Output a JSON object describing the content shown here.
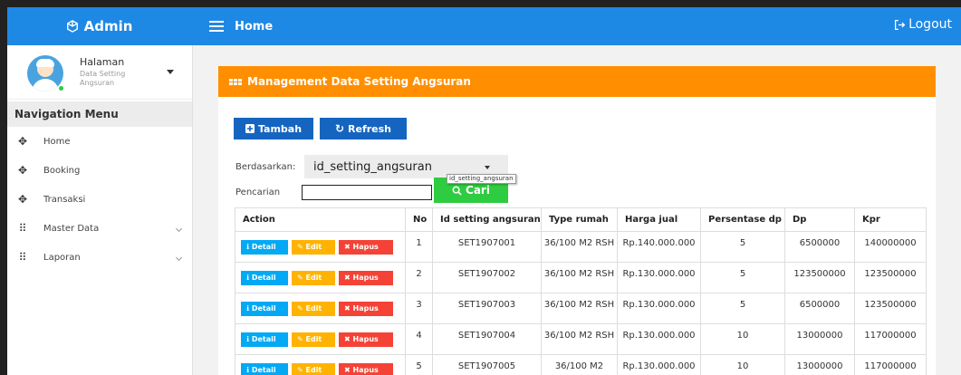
{
  "topbar": {
    "brand": "Admin",
    "title": "Home",
    "logout": "Logout",
    "colors": {
      "primary": "#1e88e5"
    }
  },
  "sidebar": {
    "user": {
      "name": "Halaman",
      "subtitle": "Data Setting Angsuran"
    },
    "nav_header": "Navigation Menu",
    "items": [
      {
        "label": "Home",
        "icon": "move-icon",
        "expandable": false
      },
      {
        "label": "Booking",
        "icon": "move-icon",
        "expandable": false
      },
      {
        "label": "Transaksi",
        "icon": "move-icon",
        "expandable": false
      },
      {
        "label": "Master Data",
        "icon": "grid-icon",
        "expandable": true
      },
      {
        "label": "Laporan",
        "icon": "grid-icon",
        "expandable": true
      }
    ]
  },
  "panel": {
    "title": "Management Data Setting Angsuran",
    "header_color": "#ff8f00",
    "buttons": {
      "add": "Tambah",
      "refresh": "Refresh"
    },
    "filter_label": "Berdasarkan:",
    "filter_value": "id_setting_angsuran",
    "filter_tooltip": "id_setting_angsuran",
    "search_label": "Pencarian",
    "search_value": "",
    "search_button": "Cari"
  },
  "table": {
    "headers": [
      "Action",
      "No",
      "Id setting angsuran",
      "Type rumah",
      "Harga jual",
      "Persentase dp",
      "Dp",
      "Kpr"
    ],
    "action_labels": {
      "detail": "Detail",
      "edit": "Edit",
      "delete": "Hapus"
    },
    "rows": [
      {
        "no": "1",
        "id": "SET1907001",
        "type": "36/100 M2 RSH",
        "harga": "Rp.140.000.000",
        "persen": "5",
        "dp": "6500000",
        "kpr": "140000000"
      },
      {
        "no": "2",
        "id": "SET1907002",
        "type": "36/100 M2 RSH",
        "harga": "Rp.130.000.000",
        "persen": "5",
        "dp": "123500000",
        "kpr": "123500000"
      },
      {
        "no": "3",
        "id": "SET1907003",
        "type": "36/100 M2 RSH",
        "harga": "Rp.130.000.000",
        "persen": "5",
        "dp": "6500000",
        "kpr": "123500000"
      },
      {
        "no": "4",
        "id": "SET1907004",
        "type": "36/100 M2 RSH",
        "harga": "Rp.130.000.000",
        "persen": "10",
        "dp": "13000000",
        "kpr": "117000000"
      },
      {
        "no": "5",
        "id": "SET1907005",
        "type": "36/100 M2",
        "harga": "Rp.130.000.000",
        "persen": "10",
        "dp": "13000000",
        "kpr": "117000000"
      }
    ]
  }
}
